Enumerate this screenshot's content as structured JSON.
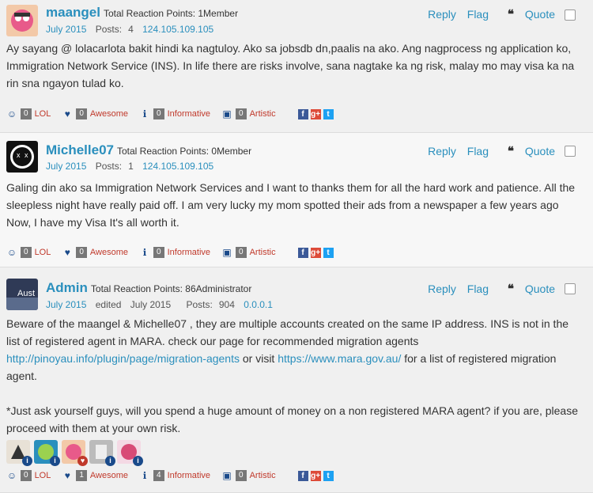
{
  "labels": {
    "reply": "Reply",
    "flag": "Flag",
    "quote": "Quote",
    "posts_label": "Posts:",
    "edited_label": "edited"
  },
  "reactions_labels": [
    "LOL",
    "Awesome",
    "Informative",
    "Artistic"
  ],
  "social": {
    "fb": "f",
    "gp": "g+",
    "tw": "t"
  },
  "posts": [
    {
      "username": "maangel",
      "reaction_text": "Total Reaction Points: 1Member",
      "date": "July 2015",
      "posts": "4",
      "ip": "124.105.109.105",
      "body": "Ay sayang @ lolacarlota bakit hindi ka nagtuloy. Ako sa jobsdb dn,paalis na ako. Ang nagprocess ng application ko, Immigration Network Service (INS). In life there are risks involve, sana nagtake ka ng risk, malay mo may visa ka na rin sna ngayon tulad ko.",
      "counts": [
        "0",
        "0",
        "0",
        "0"
      ]
    },
    {
      "username": "Michelle07",
      "reaction_text": "Total Reaction Points: 0Member",
      "date": "July 2015",
      "posts": "1",
      "ip": "124.105.109.105",
      "body": "Galing din ako sa Immigration Network Services and I want to thanks them for all the hard work and patience. All the sleepless night have really paid off. I am very lucky my mom spotted their ads from a newspaper a few years ago Now, I have my Visa It's all worth it.",
      "counts": [
        "0",
        "0",
        "0",
        "0"
      ]
    },
    {
      "username": "Admin",
      "reaction_text": "Total Reaction Points: 86Administrator",
      "date": "July 2015",
      "edited": "July 2015",
      "posts": "904",
      "ip": "0.0.0.1",
      "body_part1": "Beware of the maangel & Michelle07 , they are multiple accounts created on the same IP address. INS is not in the list of registered agent in MARA. check our page for recommended migration agents",
      "link1": "http://pinoyau.info/plugin/page/migration-agents",
      "or_visit": " or visit ",
      "link2": "https://www.mara.gov.au/",
      "body_part2": " for a list of registered migration agent.",
      "body_para2": "*Just ask yourself guys, will you spend a huge amount of money on a non registered MARA agent? if you are, please proceed with them at your own risk.",
      "counts": [
        "0",
        "1",
        "4",
        "0"
      ]
    }
  ]
}
